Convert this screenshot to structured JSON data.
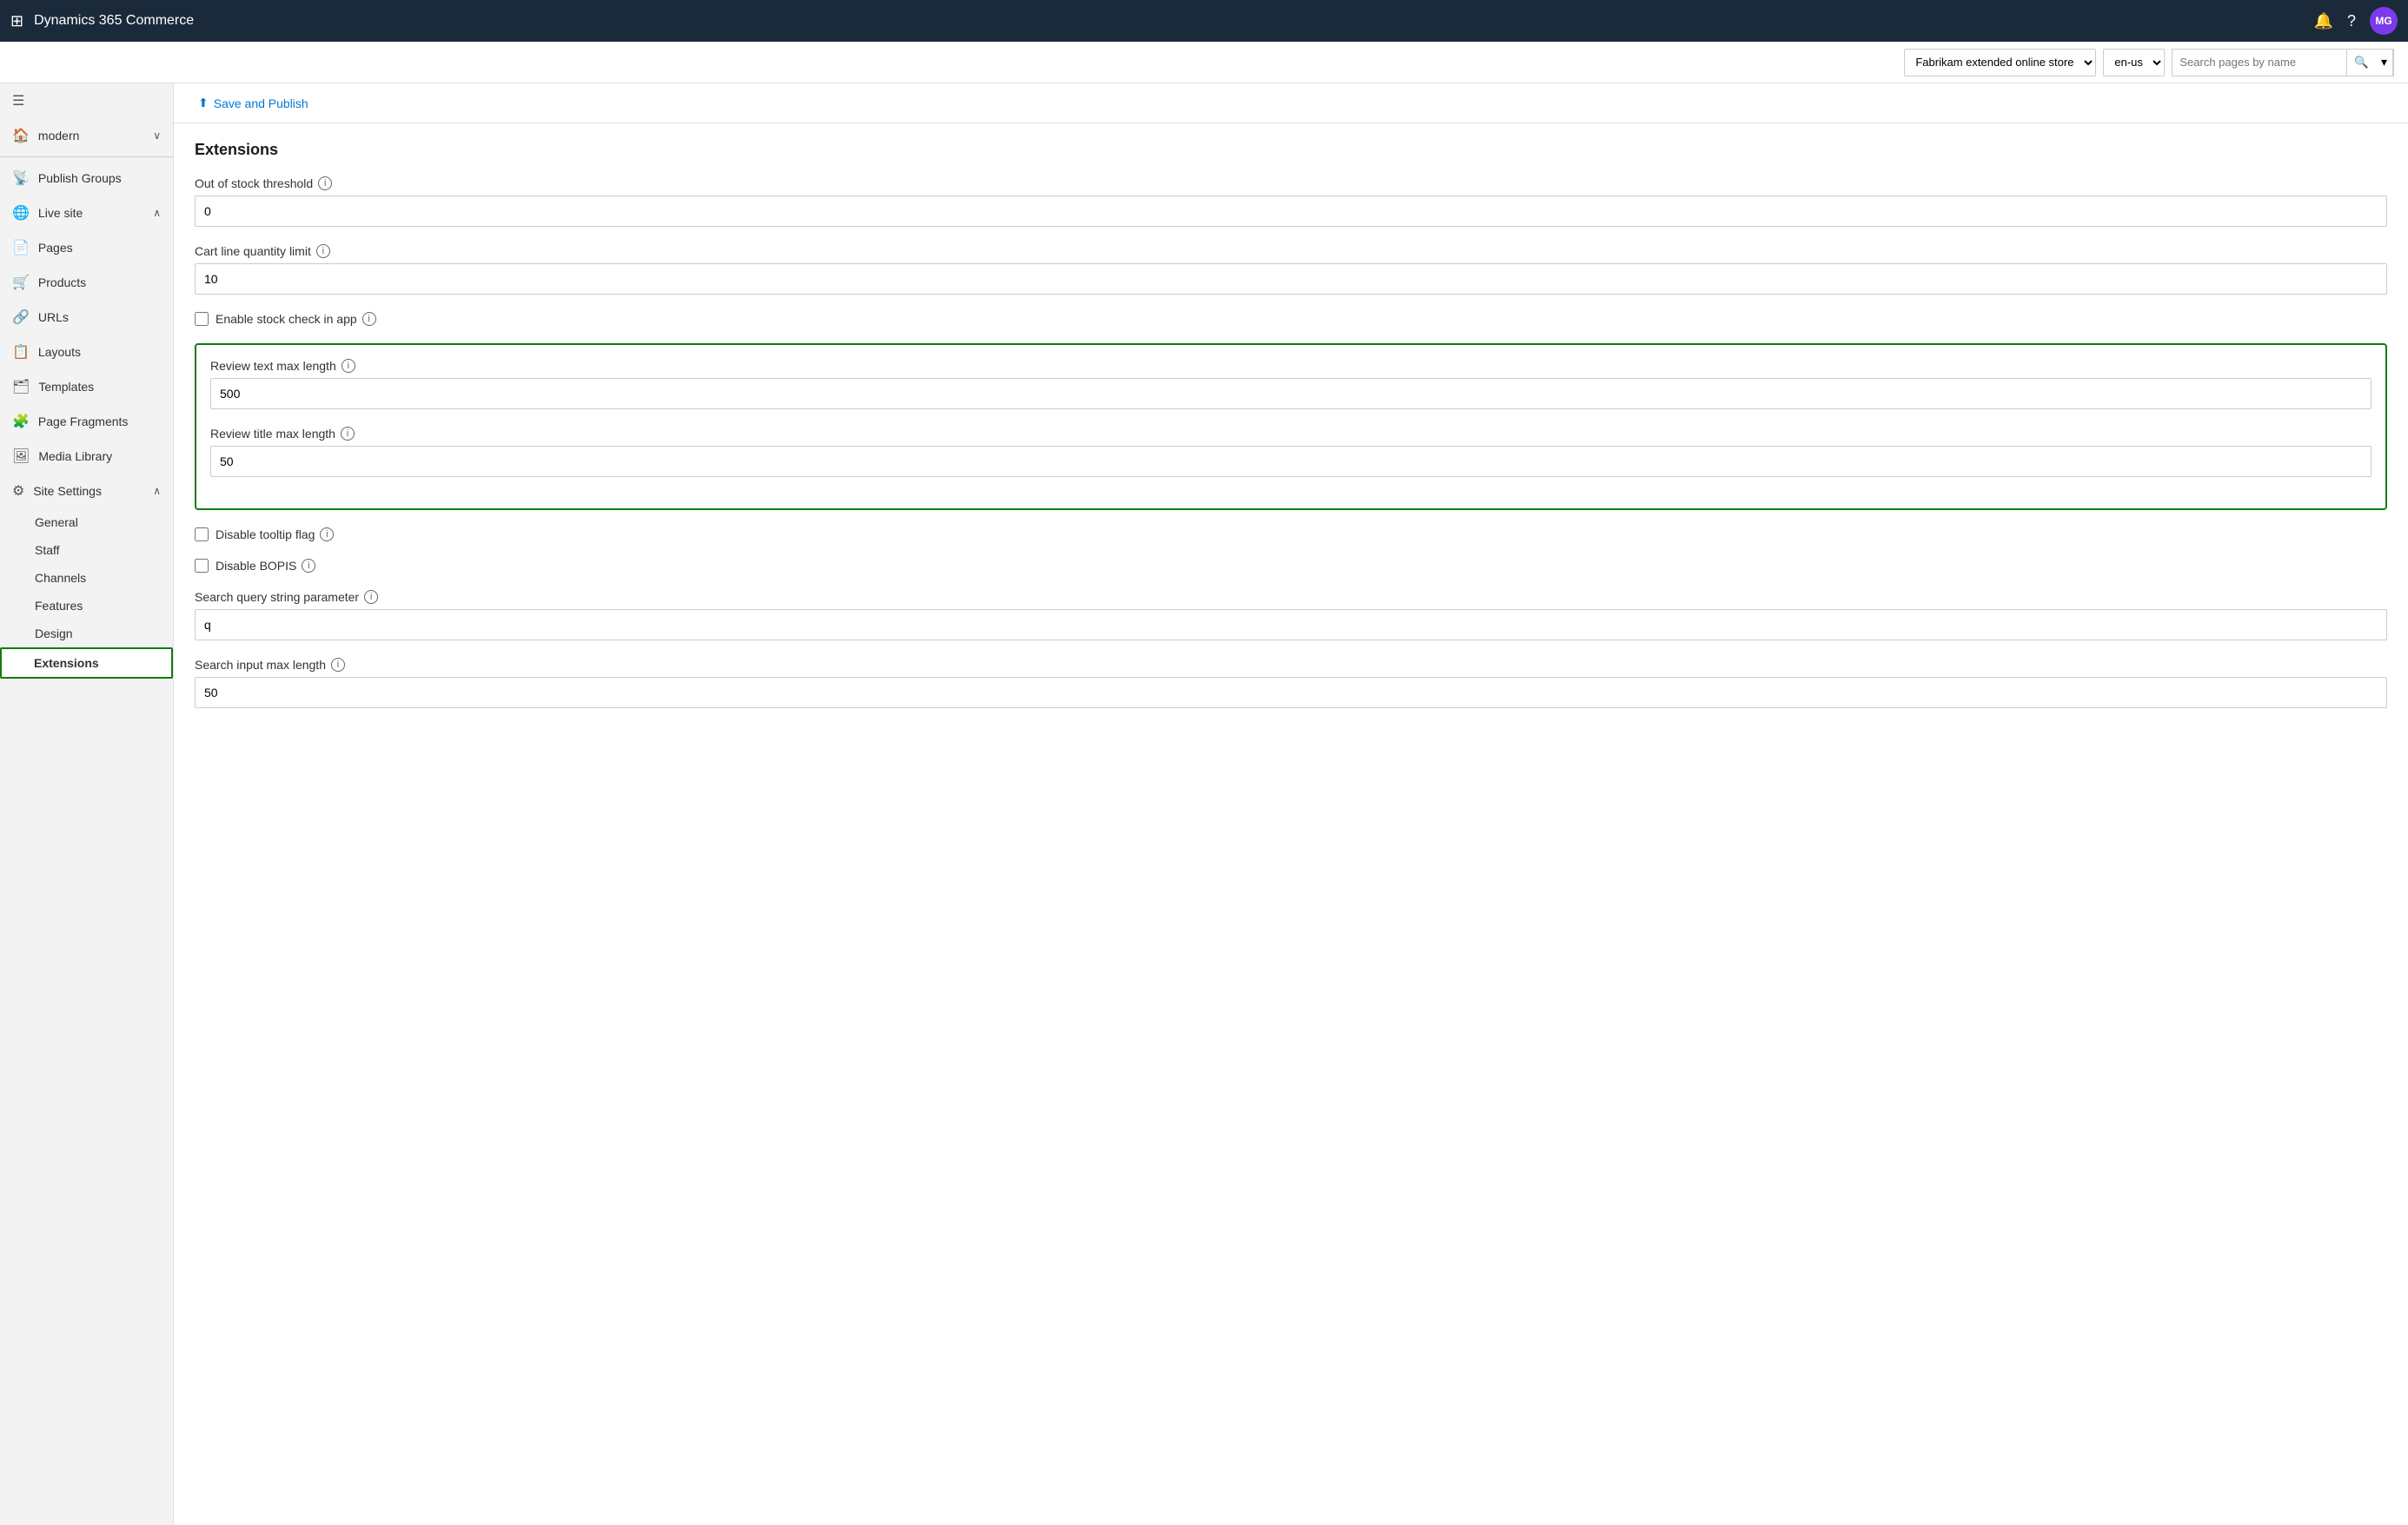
{
  "app": {
    "title": "Dynamics 365 Commerce"
  },
  "topbar": {
    "title": "Dynamics 365 Commerce",
    "avatar": "MG"
  },
  "subheader": {
    "store_options": [
      "Fabrikam extended online store"
    ],
    "store_selected": "Fabrikam extended online store",
    "locale_options": [
      "en-us"
    ],
    "locale_selected": "en-us",
    "search_placeholder": "Search pages by name"
  },
  "sidebar": {
    "site_label": "modern",
    "items": [
      {
        "id": "publish-groups",
        "label": "Publish Groups",
        "icon": "📡"
      },
      {
        "id": "live-site",
        "label": "Live site",
        "icon": "🌐",
        "chevron": "∧"
      },
      {
        "id": "pages",
        "label": "Pages",
        "icon": "📄"
      },
      {
        "id": "products",
        "label": "Products",
        "icon": "🛒"
      },
      {
        "id": "urls",
        "label": "URLs",
        "icon": "🔗"
      },
      {
        "id": "layouts",
        "label": "Layouts",
        "icon": "📋"
      },
      {
        "id": "templates",
        "label": "Templates",
        "icon": "🗂"
      },
      {
        "id": "page-fragments",
        "label": "Page Fragments",
        "icon": "🧩"
      },
      {
        "id": "media-library",
        "label": "Media Library",
        "icon": "🖼"
      },
      {
        "id": "site-settings",
        "label": "Site Settings",
        "icon": "⚙",
        "chevron": "∧"
      }
    ],
    "sub_items": [
      {
        "id": "general",
        "label": "General"
      },
      {
        "id": "staff",
        "label": "Staff"
      },
      {
        "id": "channels",
        "label": "Channels"
      },
      {
        "id": "features",
        "label": "Features"
      },
      {
        "id": "design",
        "label": "Design"
      },
      {
        "id": "extensions",
        "label": "Extensions",
        "active": true
      }
    ]
  },
  "content": {
    "save_publish_label": "Save and Publish",
    "section_title": "Extensions",
    "fields": [
      {
        "id": "out-of-stock-threshold",
        "label": "Out of stock threshold",
        "value": "0",
        "has_info": true
      },
      {
        "id": "cart-line-quantity-limit",
        "label": "Cart line quantity limit",
        "value": "10",
        "has_info": true
      }
    ],
    "checkbox_fields": [
      {
        "id": "enable-stock-check",
        "label": "Enable stock check in app",
        "checked": false,
        "has_info": true
      }
    ],
    "highlighted_fields": [
      {
        "id": "review-text-max-length",
        "label": "Review text max length",
        "value": "500",
        "has_info": true
      },
      {
        "id": "review-title-max-length",
        "label": "Review title max length",
        "value": "50",
        "has_info": true
      }
    ],
    "more_checkboxes": [
      {
        "id": "disable-tooltip-flag",
        "label": "Disable tooltip flag",
        "checked": false,
        "has_info": true
      },
      {
        "id": "disable-bopis",
        "label": "Disable BOPIS",
        "checked": false,
        "has_info": true
      }
    ],
    "more_fields": [
      {
        "id": "search-query-string-parameter",
        "label": "Search query string parameter",
        "value": "q",
        "has_info": true
      },
      {
        "id": "search-input-max-length",
        "label": "Search input max length",
        "value": "50",
        "has_info": true
      }
    ]
  }
}
